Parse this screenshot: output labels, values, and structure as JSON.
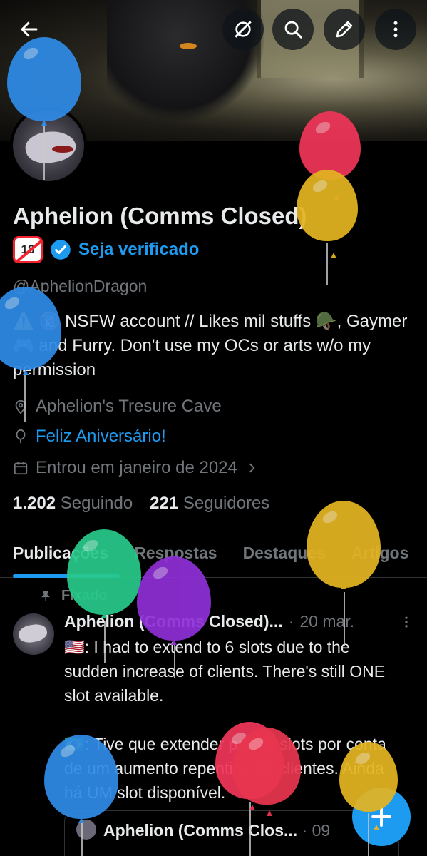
{
  "profile": {
    "name": "Aphelion (Comms Closed)",
    "age_badge": "18",
    "verify_text": "Seja verificado",
    "handle": "@AphelionDragon",
    "bio": "⚠️ 🔞 NSFW account // Likes mil stuffs 🪖, Gaymer 🎮 and Furry.  Don't use my OCs or arts w/o my permission",
    "location": "Aphelion's Tresure Cave",
    "birthday": "Feliz Aniversário!",
    "joined": "Entrou em janeiro de 2024",
    "following_count": "1.202",
    "following_label": "Seguindo",
    "followers_count": "221",
    "followers_label": "Seguidores"
  },
  "tabs": [
    {
      "label": "Publicações",
      "active": true
    },
    {
      "label": "Respostas",
      "active": false
    },
    {
      "label": "Destaques",
      "active": false
    },
    {
      "label": "Artigos",
      "active": false
    }
  ],
  "post": {
    "pinned_label": "Fixado",
    "author": "Aphelion (Comms Closed)...",
    "separator": "·",
    "date": "20 mar.",
    "text": "🇺🇸: I had to extend to 6 slots due to the sudden increase of clients. There's still ONE slot available.\n\n🇧🇷: Tive que extender para 6 slots por conta de um aumento repentino de clientes. Ainda há UM slot disponível."
  },
  "quote": {
    "author": "Aphelion (Comms Clos...",
    "separator": "·",
    "date": "09"
  },
  "icons": {
    "back": "arrow-left-icon",
    "hide": "eye-off-icon",
    "search": "search-icon",
    "edit": "pencil-icon",
    "more": "more-vertical-icon",
    "location": "location-pin-icon",
    "birthday": "balloon-icon",
    "calendar": "calendar-icon",
    "pin": "pin-icon",
    "compose": "plus-icon"
  },
  "colors": {
    "accent": "#1d9bf0",
    "background": "#000000",
    "text": "#e7e9ea",
    "muted": "#71767b"
  }
}
